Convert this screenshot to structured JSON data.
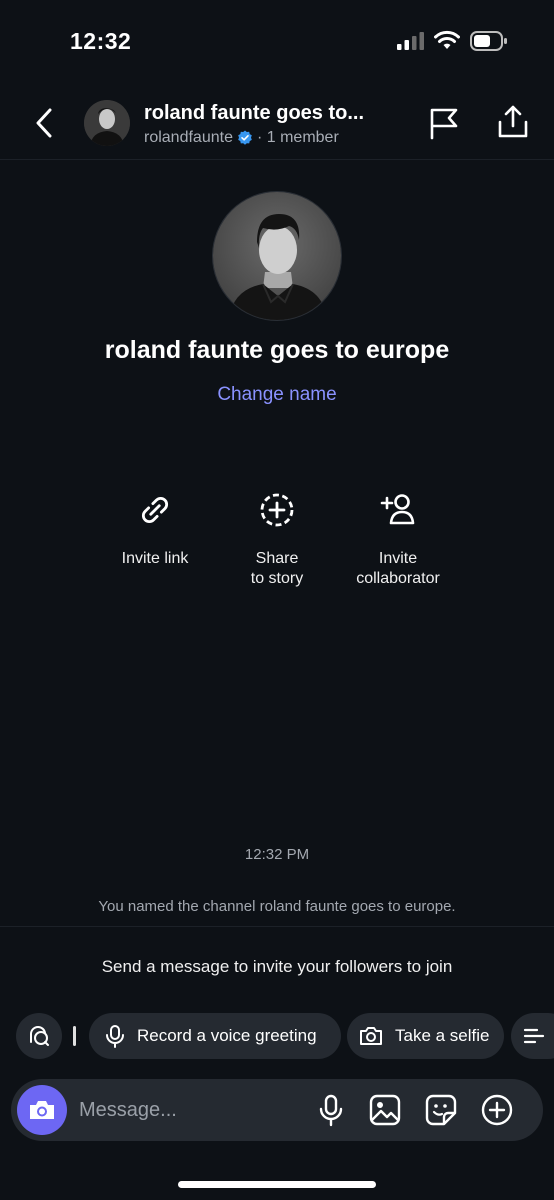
{
  "status_bar": {
    "time": "12:32"
  },
  "header": {
    "title": "roland faunte goes to...",
    "username": "rolandfaunte",
    "member_count": "· 1 member"
  },
  "channel": {
    "name": "roland faunte goes to europe",
    "change_name_label": "Change name"
  },
  "actions": [
    {
      "label": "Invite link",
      "icon": "link-icon"
    },
    {
      "label": "Share\nto story",
      "icon": "add-story-icon"
    },
    {
      "label": "Invite\ncollaborator",
      "icon": "add-person-icon"
    }
  ],
  "feed": {
    "timestamp": "12:32 PM",
    "system_message": "You named the channel roland faunte goes to europe.",
    "invite_prompt": "Send a message to invite your followers to join"
  },
  "chips": {
    "voice_label": "Record a voice greeting",
    "selfie_label": "Take a selfie"
  },
  "composer": {
    "placeholder": "Message..."
  },
  "colors": {
    "background": "#0d1116",
    "accent_link": "#8a92ff",
    "camera_button": "#6d67f3",
    "chip_bg": "#252a31",
    "verified_badge": "#3897f0"
  }
}
